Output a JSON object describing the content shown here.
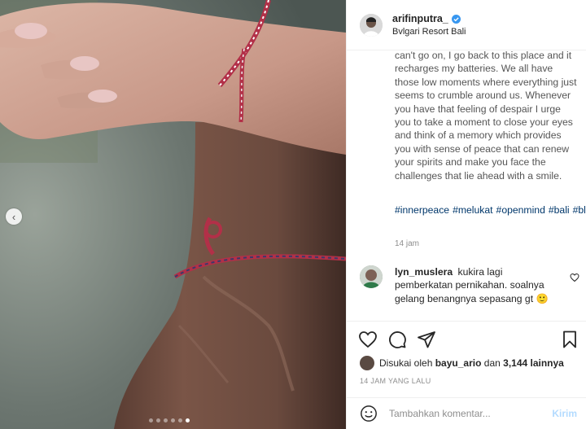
{
  "post": {
    "username": "arifinputra_",
    "verified": true,
    "location": "Bvlgari Resort Bali",
    "caption": "can't go on, I go back to this place and it recharges my batteries. We all have those low moments where everything just seems to crumble around us. Whenever you have that feeling of despair I urge you to take a moment to close your eyes and think of a memory which provides you with sense of peace that can renew your spirits and make you face the challenges that lie ahead with a smile.",
    "hashtags": [
      "#innerpeace",
      "#melukat",
      "#openmind",
      "#bali",
      "#blessed"
    ],
    "time_ago": "14 jam",
    "carousel": {
      "slide_count": 6,
      "active_index": 5
    }
  },
  "comments": [
    {
      "username": "lyn_muslera",
      "text": "kukira lagi pemberkatan pernikahan. soalnya gelang benangnya sepasang gt 🙂"
    }
  ],
  "likes": {
    "prefix": "Disukai oleh",
    "first_user": "bayu_ario",
    "conjunction": "dan",
    "others": "3,144 lainnya"
  },
  "timestamp": "14 JAM YANG LALU",
  "comment_box": {
    "placeholder": "Tambahkan komentar...",
    "post_label": "Kirim"
  },
  "colors": {
    "link": "#00376b",
    "verified": "#3897f0",
    "post_button": "#b3dbff",
    "muted": "#8e8e8e"
  },
  "icons": [
    "chevron-left-icon",
    "verified-badge-icon",
    "heart-icon",
    "comment-icon",
    "share-icon",
    "bookmark-icon",
    "emoji-icon"
  ]
}
